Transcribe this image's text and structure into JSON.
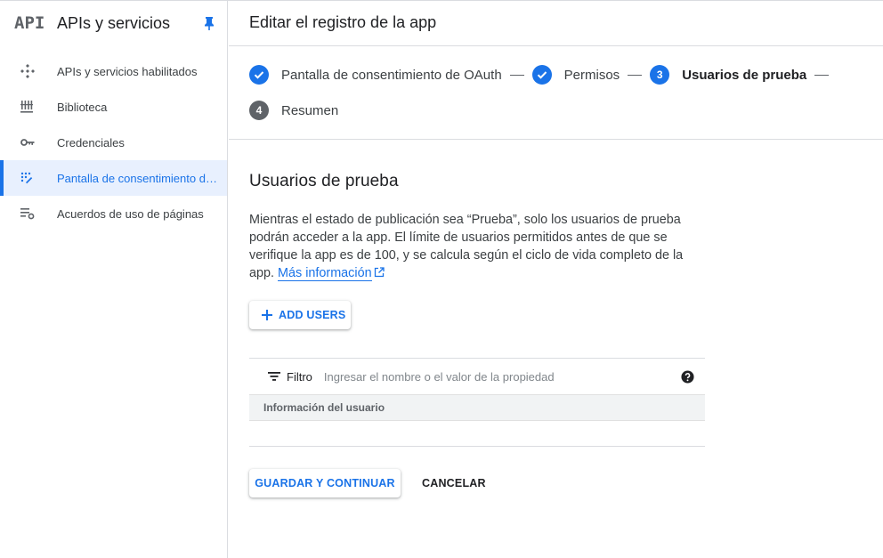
{
  "sidebar": {
    "logo": "API",
    "title": "APIs y servicios",
    "items": [
      {
        "label": "APIs y servicios habilitados",
        "icon": "apis-diamond-icon",
        "active": false
      },
      {
        "label": "Biblioteca",
        "icon": "library-icon",
        "active": false
      },
      {
        "label": "Credenciales",
        "icon": "key-icon",
        "active": false
      },
      {
        "label": "Pantalla de consentimiento de OAuth",
        "icon": "consent-screen-icon",
        "active": true
      },
      {
        "label": "Acuerdos de uso de páginas",
        "icon": "settings-list-icon",
        "active": false
      }
    ]
  },
  "header": {
    "title": "Editar el registro de la app"
  },
  "stepper": {
    "steps": [
      {
        "label": "Pantalla de consentimiento de OAuth",
        "state": "done"
      },
      {
        "label": "Permisos",
        "state": "done"
      },
      {
        "number": "3",
        "label": "Usuarios de prueba",
        "state": "current"
      },
      {
        "number": "4",
        "label": "Resumen",
        "state": "todo"
      }
    ]
  },
  "content": {
    "heading": "Usuarios de prueba",
    "description": "Mientras el estado de publicación sea “Prueba”, solo los usuarios de prueba podrán acceder a la app. El límite de usuarios permitidos antes de que se verifique la app es de 100, y se calcula según el ciclo de vida completo de la app.",
    "link": "Más información",
    "add_users": "ADD USERS"
  },
  "table": {
    "filter_label": "Filtro",
    "filter_placeholder": "Ingresar el nombre o el valor de la propiedad",
    "column": "Información del usuario"
  },
  "actions": {
    "save": "GUARDAR Y CONTINUAR",
    "cancel": "CANCELAR"
  },
  "colors": {
    "accent": "#1a73e8",
    "active_bg": "#e8f0fe",
    "border": "#dadce0"
  }
}
